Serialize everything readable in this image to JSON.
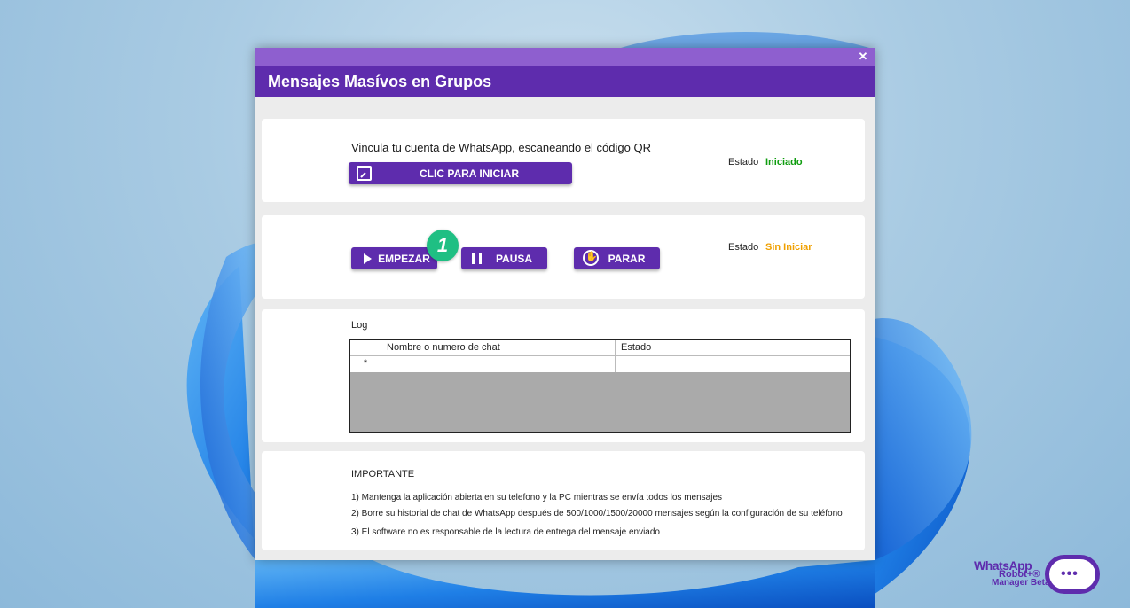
{
  "window": {
    "minimize_glyph": "–",
    "close_glyph": "✕",
    "title": "Mensajes Masívos en Grupos"
  },
  "connect": {
    "instruction": "Vincula tu cuenta de WhatsApp, escaneando el código QR",
    "button_label": "CLIC PARA INICIAR",
    "status_label": "Estado",
    "status_value": "Iniciado",
    "status_color": "#0f9d0f"
  },
  "controls": {
    "start_label": "EMPEZAR",
    "pause_label": "PAUSA",
    "stop_label": "PARAR",
    "status_label": "Estado",
    "status_value": "Sin Iniciar",
    "status_color": "#f0a000",
    "step_badge": "1"
  },
  "log": {
    "title": "Log",
    "columns": [
      "",
      "Nombre o numero de chat",
      "Estado"
    ],
    "new_row_marker": "*"
  },
  "important": {
    "title": "IMPORTANTE",
    "lines": [
      "1) Mantenga la aplicación abierta en su telefono y la PC mientras se envía todos los mensajes",
      "2) Borre su historial de chat de WhatsApp después de 500/1000/1500/20000 mensajes según la configuración de su teléfono",
      "3) El software no es responsable de la lectura de entrega del mensaje enviado"
    ]
  },
  "brand": {
    "line1": "WhatsApp",
    "line2": "Robot+®",
    "line3": "Manager Beta",
    "face_glyph": "•••"
  },
  "colors": {
    "accent": "#5e2cad",
    "titlebar": "#8e5fcf",
    "badge": "#1fbf83"
  }
}
